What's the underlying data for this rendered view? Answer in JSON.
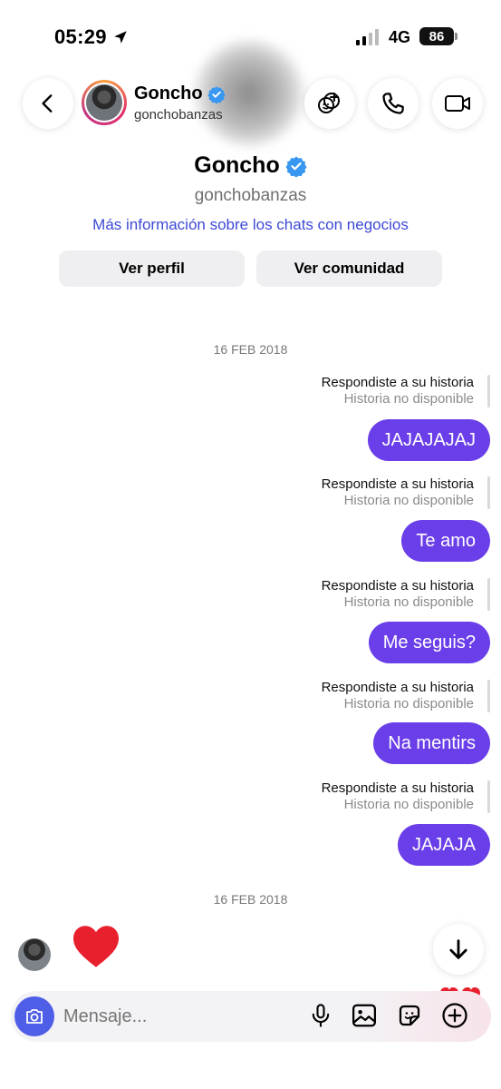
{
  "status_bar": {
    "time": "05:29",
    "network": "4G",
    "battery": "86"
  },
  "header": {
    "name": "Goncho",
    "username": "gonchobanzas"
  },
  "profile": {
    "name": "Goncho",
    "username": "gonchobanzas",
    "info_link": "Más información sobre los chats con negocios",
    "view_profile": "Ver perfil",
    "view_community": "Ver comunidad"
  },
  "dates": [
    "16 FEB 2018",
    "16 FEB 2018"
  ],
  "messages": [
    {
      "reply_label": "Respondiste a su historia",
      "story_status": "Historia no disponible",
      "text": "JAJAJAJAJ"
    },
    {
      "reply_label": "Respondiste a su historia",
      "story_status": "Historia no disponible",
      "text": "Te amo"
    },
    {
      "reply_label": "Respondiste a su historia",
      "story_status": "Historia no disponible",
      "text": "Me seguis?"
    },
    {
      "reply_label": "Respondiste a su historia",
      "story_status": "Historia no disponible",
      "text": "Na mentirs"
    },
    {
      "reply_label": "Respondiste a su historia",
      "story_status": "Historia no disponible",
      "text": "JAJAJA"
    }
  ],
  "composer": {
    "placeholder": "Mensaje..."
  },
  "colors": {
    "bubble": "#6a3ee8",
    "link": "#3e49d6",
    "camera": "#4f5ee6",
    "heart": "#e8202e",
    "verified": "#3897f0"
  },
  "icons": [
    "location-arrow-icon",
    "back-icon",
    "verified-icon",
    "add-effects-icon",
    "phone-icon",
    "video-icon",
    "heart-icon",
    "arrow-down-icon",
    "camera-icon",
    "microphone-icon",
    "gallery-icon",
    "sticker-icon",
    "plus-icon"
  ]
}
